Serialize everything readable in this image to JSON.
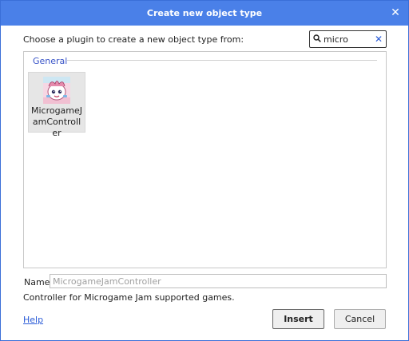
{
  "dialog": {
    "title": "Create new object type",
    "close_glyph": "✕"
  },
  "prompt": "Choose a plugin to create a new object type from:",
  "search": {
    "value": "micro",
    "clear_glyph": "✕",
    "icon": "search-icon"
  },
  "list": {
    "group": "General",
    "items": [
      {
        "label": "MicrogameJamController",
        "icon": "plugin-mascot-icon"
      }
    ]
  },
  "name": {
    "label": "Name",
    "placeholder": "MicrogameJamController",
    "value": ""
  },
  "description": "Controller for Microgame Jam supported games.",
  "footer": {
    "help": "Help",
    "insert": "Insert",
    "cancel": "Cancel"
  },
  "colors": {
    "titlebar": "#4a80e8",
    "link": "#2a5bd7",
    "group_label": "#3a55c8"
  }
}
